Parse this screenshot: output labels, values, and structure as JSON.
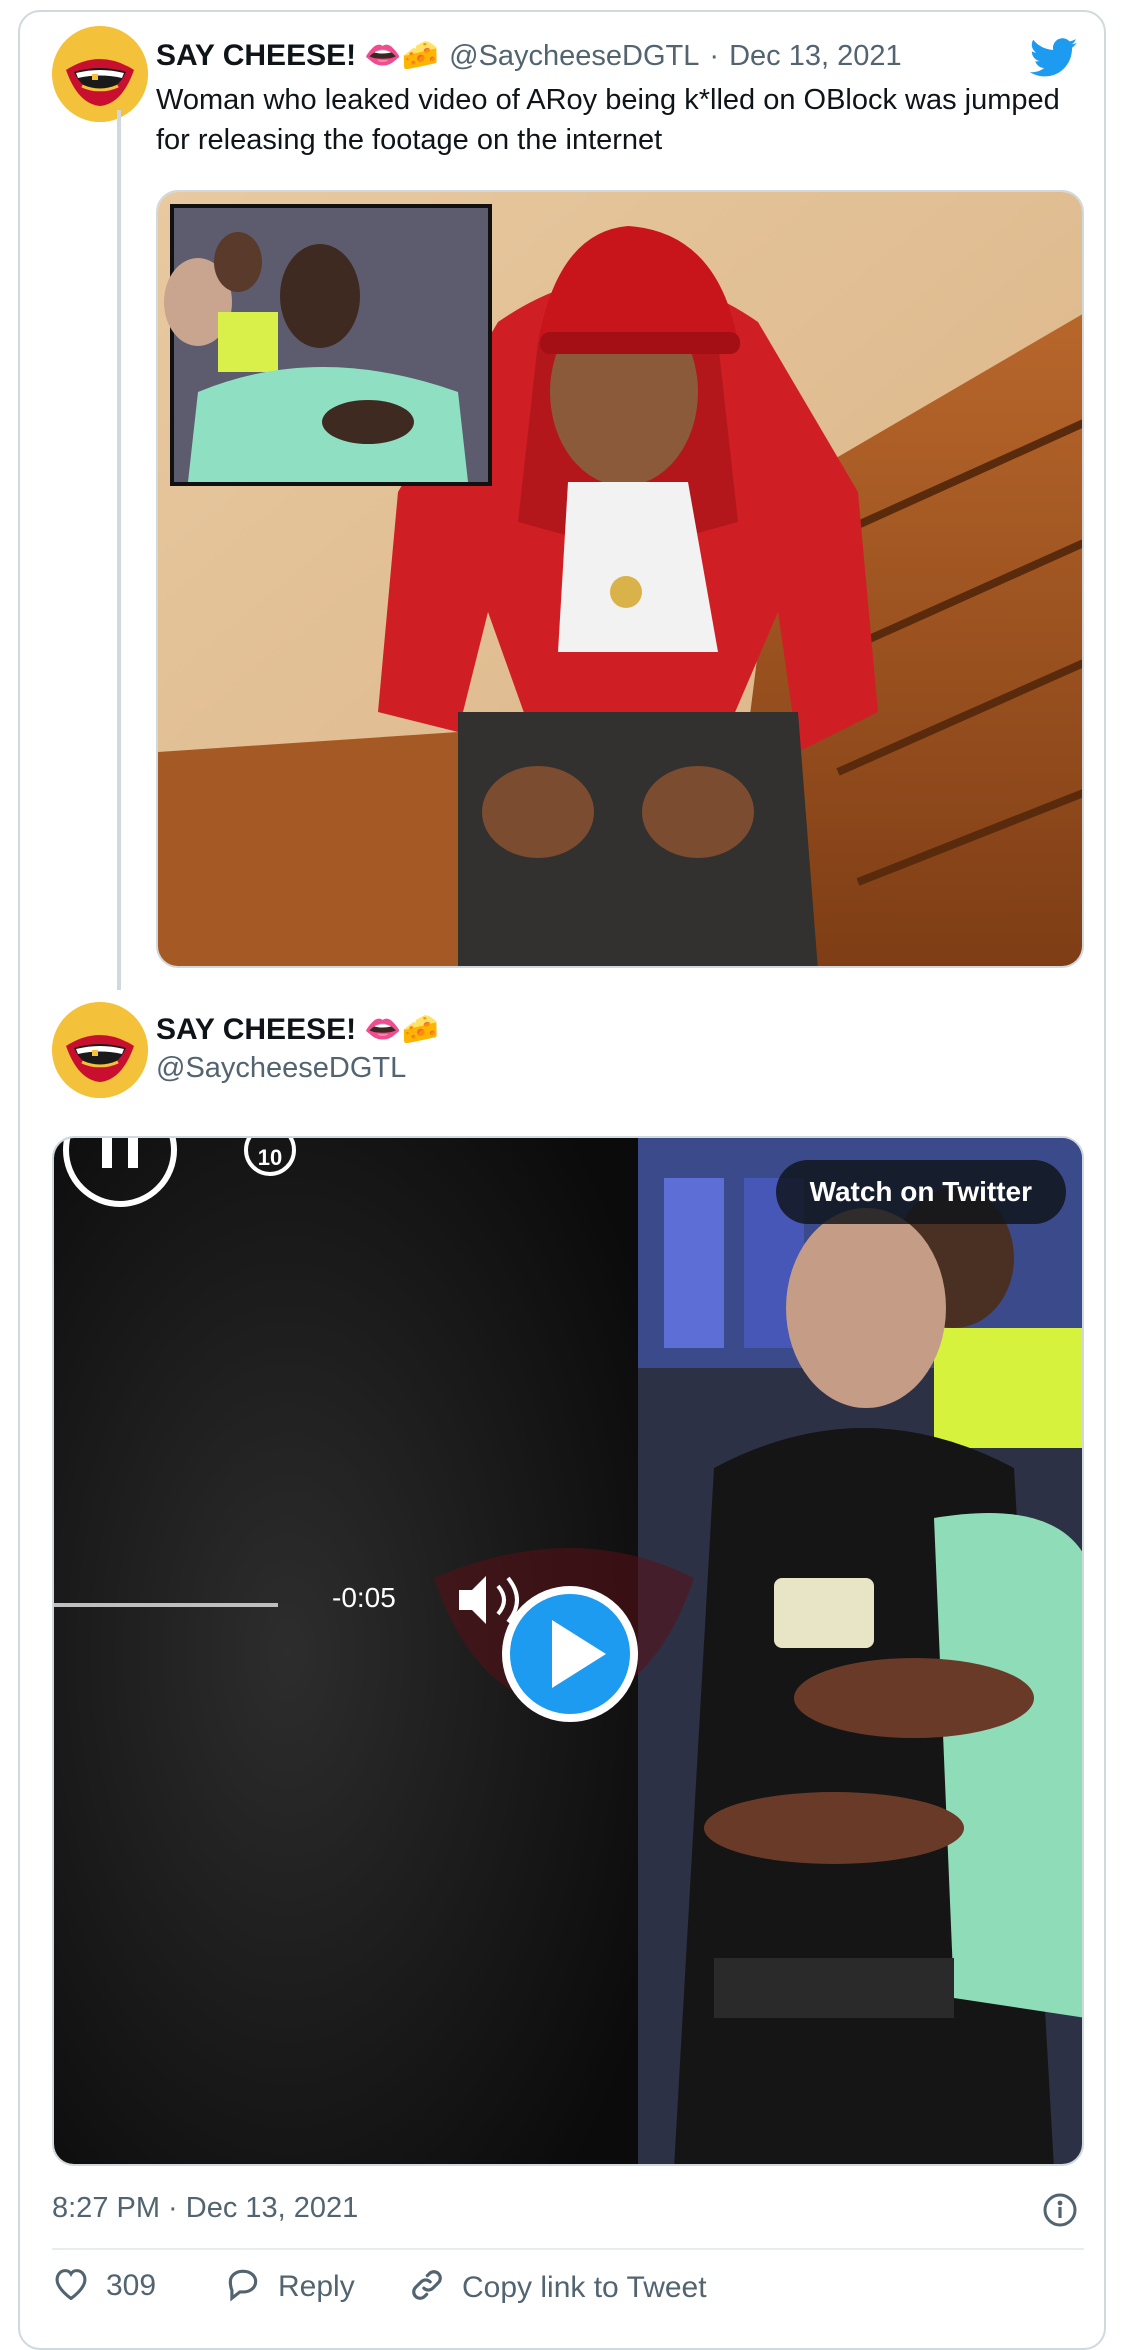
{
  "tweet": {
    "display_name": "SAY CHEESE! 👄🧀",
    "handle": "@SaycheeseDGTL",
    "date": "Dec 13, 2021",
    "separator": "·",
    "text": "Woman who leaked video of ARoy being k*lled on OBlock was jumped for releasing the footage on the internet"
  },
  "reply": {
    "display_name": "SAY CHEESE! 👄🧀",
    "handle": "@SaycheeseDGTL",
    "video": {
      "watch_label": "Watch on Twitter",
      "time_remaining": "-0:05",
      "skip_label": "10"
    }
  },
  "footer": {
    "timestamp": "8:27 PM · Dec 13, 2021",
    "like_count": "309",
    "reply_label": "Reply",
    "copy_label": "Copy link to Tweet"
  },
  "colors": {
    "brand": "#1d9bf0",
    "text_secondary": "#536471",
    "border": "#cfd9de"
  },
  "icons": [
    "twitter-bird-icon",
    "info-icon",
    "heart-icon",
    "reply-icon",
    "link-icon",
    "play-icon",
    "pause-icon",
    "volume-icon"
  ]
}
